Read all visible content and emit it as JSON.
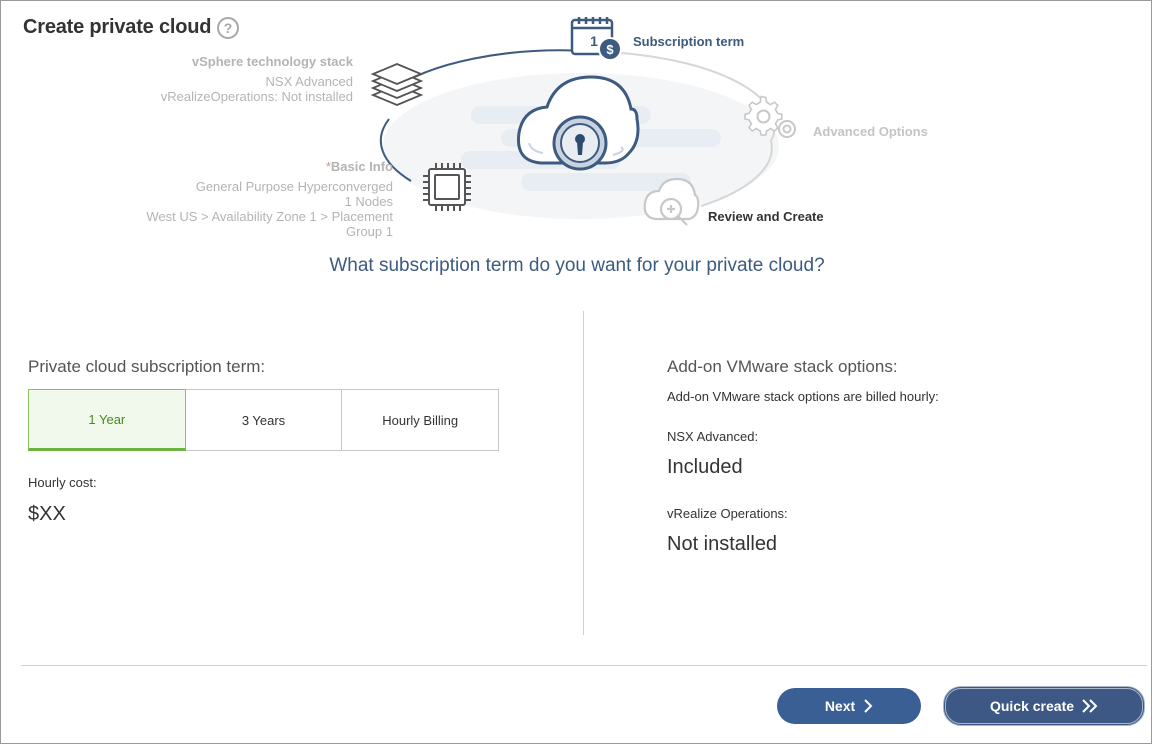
{
  "window": {
    "title": "Create private cloud",
    "help_icon": "question-circle-icon",
    "help_glyph": "?"
  },
  "steps": {
    "vsphere": {
      "heading": "vSphere technology stack",
      "lines": [
        "NSX Advanced",
        "vRealizeOperations: Not installed"
      ],
      "icon": "layers-stack-icon"
    },
    "basic_info": {
      "required_mark": "*",
      "heading": "Basic Info",
      "lines": [
        "General Purpose Hyperconverged",
        "1 Nodes",
        "West US > Availability Zone 1 > Placement",
        "Group 1"
      ],
      "icon": "cpu-chip-icon"
    },
    "subscription_term": {
      "label": "Subscription term",
      "icon": "calendar-dollar-icon",
      "calendar_day": "1",
      "badge": "$"
    },
    "advanced_options": {
      "label": "Advanced Options",
      "icon": "gears-icon"
    },
    "review_create": {
      "label": "Review and Create",
      "icon": "cloud-search-icon"
    },
    "center_icon": "cloud-lock-icon"
  },
  "question": "What subscription term do you want for your private cloud?",
  "left_panel": {
    "heading": "Private cloud subscription term:",
    "terms": [
      {
        "label": "1 Year",
        "selected": true
      },
      {
        "label": "3 Years",
        "selected": false
      },
      {
        "label": "Hourly Billing",
        "selected": false
      }
    ],
    "hourly_cost_label": "Hourly cost:",
    "hourly_cost_value": "$XX"
  },
  "right_panel": {
    "heading": "Add-on VMware stack options:",
    "note": "Add-on VMware stack options are billed hourly:",
    "nsx_label": "NSX Advanced:",
    "nsx_value": "Included",
    "vrealize_label": "vRealize Operations:",
    "vrealize_value": "Not installed"
  },
  "footer": {
    "next_label": "Next",
    "next_icon": "chevron-right-icon",
    "quick_create_label": "Quick create",
    "quick_create_icon": "double-chevron-right-icon"
  },
  "colors": {
    "accent_blue": "#3a5f95",
    "selected_green": "#6db33f",
    "question_blue": "#3d5a80",
    "muted_gray": "#b4b4b4",
    "active_step": "#3d5a80"
  }
}
